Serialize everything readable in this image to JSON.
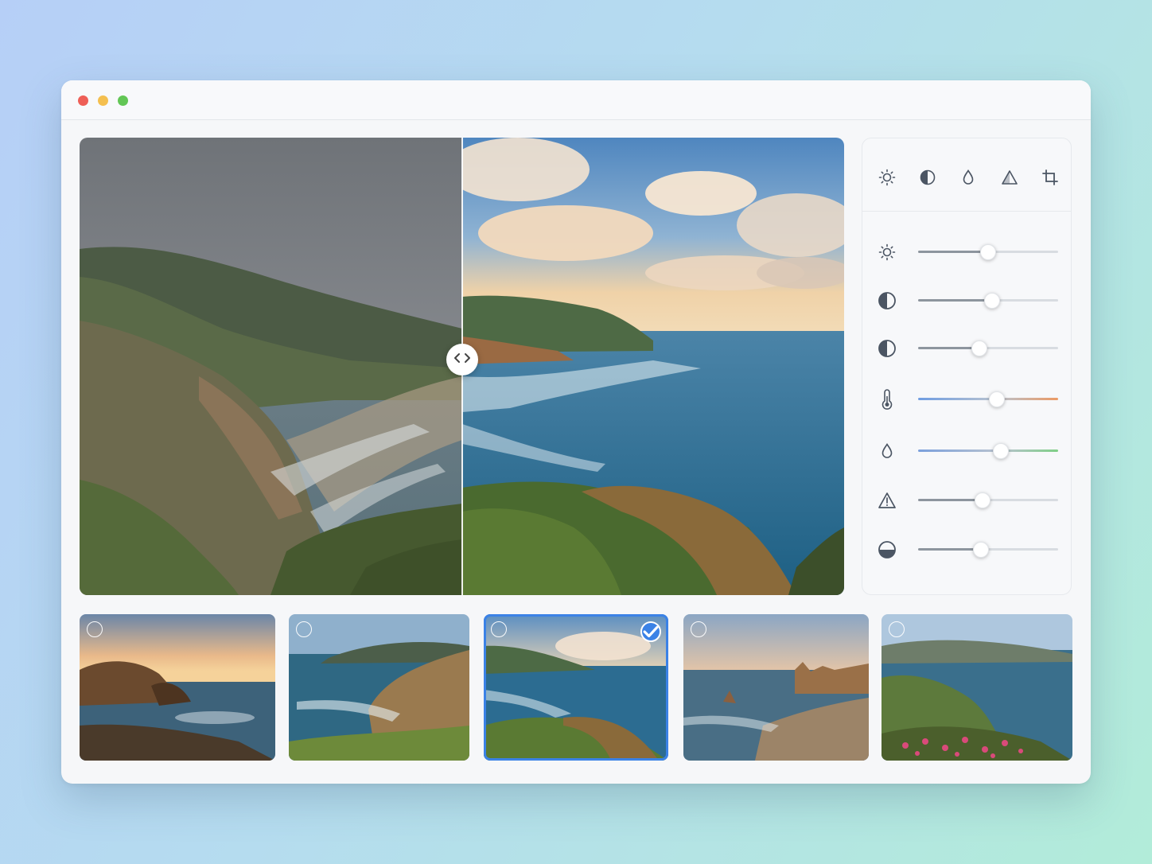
{
  "window": {
    "traffic_lights": [
      {
        "name": "close",
        "color": "#ee5f57"
      },
      {
        "name": "minimize",
        "color": "#f4bf4f"
      },
      {
        "name": "zoom",
        "color": "#62c655"
      }
    ]
  },
  "viewer": {
    "before_image": "coastal-cliffs-original",
    "after_image": "coastal-cliffs-edited",
    "split_handle_icon": "chevrons-left-right-icon"
  },
  "toolbar": {
    "tools": [
      {
        "name": "light",
        "icon": "sun-icon"
      },
      {
        "name": "contrast",
        "icon": "half-circle-icon"
      },
      {
        "name": "color",
        "icon": "droplet-icon"
      },
      {
        "name": "sharpen",
        "icon": "triangle-icon"
      },
      {
        "name": "crop",
        "icon": "crop-icon"
      }
    ]
  },
  "adjustments": [
    {
      "name": "exposure",
      "icon": "sun-icon",
      "value": 0.5,
      "track": "neutral"
    },
    {
      "name": "contrast",
      "icon": "contrast-icon",
      "value": 0.53,
      "track": "neutral"
    },
    {
      "name": "highlights",
      "icon": "contrast-icon",
      "value": 0.44,
      "track": "neutral"
    },
    {
      "name": "temperature",
      "icon": "thermometer-icon",
      "value": 0.56,
      "track": "temperature",
      "colors": [
        "#6f9de2",
        "#ec9a64"
      ]
    },
    {
      "name": "tint",
      "icon": "droplet-icon",
      "value": 0.59,
      "track": "tint",
      "colors": [
        "#7ba0dc",
        "#7fcf86"
      ]
    },
    {
      "name": "sharpness",
      "icon": "triangle-icon",
      "value": 0.46,
      "track": "neutral"
    },
    {
      "name": "vignette",
      "icon": "half-circle-icon",
      "value": 0.45,
      "track": "neutral"
    }
  ],
  "filmstrip": [
    {
      "name": "sunset-sea-stacks",
      "selected": false
    },
    {
      "name": "green-cliff-bay",
      "selected": false
    },
    {
      "name": "coastal-cliffs",
      "selected": true
    },
    {
      "name": "beach-sea-stacks",
      "selected": false
    },
    {
      "name": "flower-headland",
      "selected": false
    }
  ],
  "colors": {
    "accent": "#3b82e6"
  }
}
